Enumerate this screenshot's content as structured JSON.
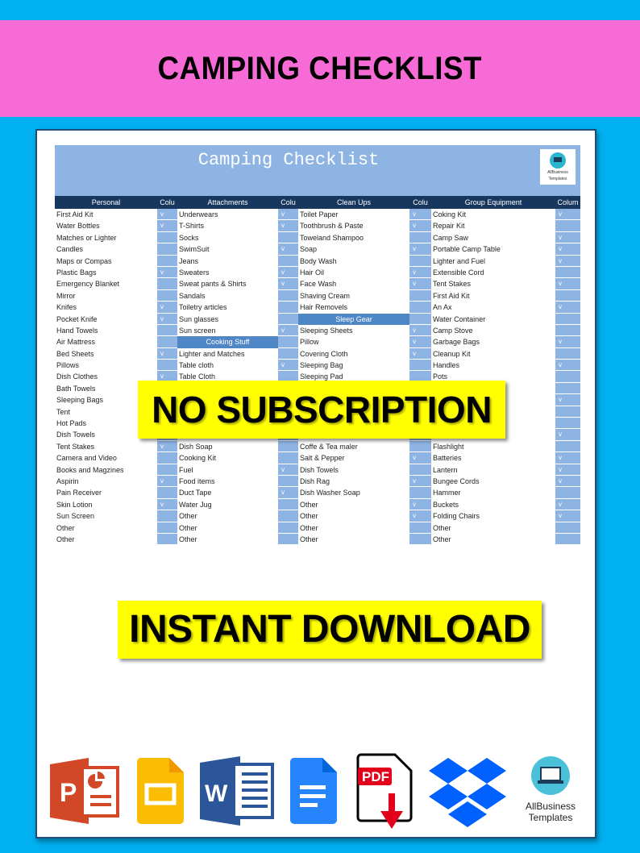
{
  "page": {
    "title": "CAMPING CHECKLIST",
    "colors": {
      "background": "#00b0f0",
      "title_band": "#f76bd6",
      "banner": "#ffff00",
      "sheet_header": "#17375e",
      "sheet_title_band": "#8eb4e3",
      "section_header": "#4f86c6"
    }
  },
  "sheet": {
    "title": "Camping Checklist",
    "logo_text_1": "AllBusiness",
    "logo_text_2": "Templates",
    "headers": [
      "Personal",
      "Colu",
      "Attachments",
      "Colu",
      "Clean Ups",
      "Colu",
      "Group Equipment",
      "Colum"
    ],
    "check_mark": "v",
    "columns": [
      {
        "name": "Personal",
        "rows": [
          {
            "label": "First Aid Kit",
            "checked": true
          },
          {
            "label": "Water Bottles",
            "checked": true
          },
          {
            "label": "Matches or Lighter",
            "checked": false
          },
          {
            "label": "Candles",
            "checked": false
          },
          {
            "label": "Maps or Compas",
            "checked": false
          },
          {
            "label": "Plastic Bags",
            "checked": true
          },
          {
            "label": "Emergency Blanket",
            "checked": false
          },
          {
            "label": "Mirror",
            "checked": false
          },
          {
            "label": "Knifes",
            "checked": true
          },
          {
            "label": "Pocket Knife",
            "checked": true
          },
          {
            "label": "Hand Towels",
            "checked": false
          },
          {
            "label": "Air Mattress",
            "checked": false
          },
          {
            "label": "Bed Sheets",
            "checked": true
          },
          {
            "label": "Pillows",
            "checked": false
          },
          {
            "label": "Dish Clothes",
            "checked": true
          },
          {
            "label": "Bath Towels",
            "checked": false
          },
          {
            "label": "Sleeping Bags",
            "checked": false
          },
          {
            "label": "Tent",
            "checked": false
          },
          {
            "label": "Hot Pads",
            "checked": false
          },
          {
            "label": "Dish Towels",
            "checked": false
          },
          {
            "label": "Tent Stakes",
            "checked": true
          },
          {
            "label": "Camera and Video",
            "checked": false
          },
          {
            "label": "Books and Magzines",
            "checked": false
          },
          {
            "label": "Aspirin",
            "checked": true
          },
          {
            "label": "Pain Receiver",
            "checked": false
          },
          {
            "label": "Skin Lotion",
            "checked": true
          },
          {
            "label": "Sun Screen",
            "checked": false
          },
          {
            "label": "Other",
            "checked": false
          },
          {
            "label": "Other",
            "checked": false
          }
        ]
      },
      {
        "name": "Attachments",
        "rows": [
          {
            "label": "Underwears",
            "checked": true
          },
          {
            "label": "T-Shirts",
            "checked": true
          },
          {
            "label": "Socks",
            "checked": false
          },
          {
            "label": "SwimSuit",
            "checked": true
          },
          {
            "label": "Jeans",
            "checked": false
          },
          {
            "label": "Sweaters",
            "checked": true
          },
          {
            "label": "Sweat pants & Shirts",
            "checked": true
          },
          {
            "label": "Sandals",
            "checked": false
          },
          {
            "label": "Toiletry articles",
            "checked": false
          },
          {
            "label": "Sun glasses",
            "checked": false
          },
          {
            "label": "Sun screen",
            "checked": true
          },
          {
            "label": "Cooking Stuff",
            "section": true,
            "checked": false
          },
          {
            "label": "Lighter and Matches",
            "checked": false
          },
          {
            "label": "Table cloth",
            "checked": true
          },
          {
            "label": "Table Cloth",
            "checked": false
          },
          {
            "label": "",
            "checked": false
          },
          {
            "label": "",
            "checked": false
          },
          {
            "label": "",
            "checked": false
          },
          {
            "label": "",
            "checked": false
          },
          {
            "label": "",
            "checked": false
          },
          {
            "label": "Dish Soap",
            "checked": false
          },
          {
            "label": "Cooking Kit",
            "checked": false
          },
          {
            "label": "Fuel",
            "checked": true
          },
          {
            "label": "Food items",
            "checked": false
          },
          {
            "label": "Duct Tape",
            "checked": true
          },
          {
            "label": "Water Jug",
            "checked": false
          },
          {
            "label": "Other",
            "checked": false
          },
          {
            "label": "Other",
            "checked": false
          },
          {
            "label": "Other",
            "checked": false
          }
        ]
      },
      {
        "name": "Clean Ups",
        "rows": [
          {
            "label": "Toilet Paper",
            "checked": true
          },
          {
            "label": "Toothbrush & Paste",
            "checked": true
          },
          {
            "label": "Toweland Shampoo",
            "checked": false
          },
          {
            "label": "Soap",
            "checked": true
          },
          {
            "label": "Body Wash",
            "checked": false
          },
          {
            "label": "Hair Oil",
            "checked": true
          },
          {
            "label": "Face Wash",
            "checked": true
          },
          {
            "label": "Shaving Cream",
            "checked": false
          },
          {
            "label": "Hair Removels",
            "checked": false
          },
          {
            "label": "Sleep Gear",
            "section": true,
            "checked": false
          },
          {
            "label": "Sleeping Sheets",
            "checked": true
          },
          {
            "label": "Pillow",
            "checked": true
          },
          {
            "label": "Covering Cloth",
            "checked": true
          },
          {
            "label": "Sleeping Bag",
            "checked": false
          },
          {
            "label": "Sleeping Pad",
            "checked": false
          },
          {
            "label": "",
            "checked": false
          },
          {
            "label": "",
            "checked": false
          },
          {
            "label": "",
            "checked": false
          },
          {
            "label": "",
            "checked": false
          },
          {
            "label": "",
            "checked": false
          },
          {
            "label": "Coffe & Tea maler",
            "checked": false
          },
          {
            "label": "Salt & Pepper",
            "checked": true
          },
          {
            "label": "Dish Towels",
            "checked": false
          },
          {
            "label": "Dish Rag",
            "checked": true
          },
          {
            "label": "Dish Washer Soap",
            "checked": false
          },
          {
            "label": "Other",
            "checked": true
          },
          {
            "label": "Other",
            "checked": true
          },
          {
            "label": "Other",
            "checked": false
          },
          {
            "label": "Other",
            "checked": false
          }
        ]
      },
      {
        "name": "Group Equipment",
        "rows": [
          {
            "label": "Coking Kit",
            "checked": true
          },
          {
            "label": "Repair Kit",
            "checked": false
          },
          {
            "label": "Camp Saw",
            "checked": true
          },
          {
            "label": "Portable Camp Table",
            "checked": true
          },
          {
            "label": "Lighter and Fuel",
            "checked": true
          },
          {
            "label": "Extensible Cord",
            "checked": false
          },
          {
            "label": "Tent Stakes",
            "checked": true
          },
          {
            "label": "First Aid Kit",
            "checked": false
          },
          {
            "label": "An Ax",
            "checked": true
          },
          {
            "label": "Water Container",
            "checked": false
          },
          {
            "label": "Camp Stove",
            "checked": false
          },
          {
            "label": "Garbage Bags",
            "checked": true
          },
          {
            "label": "Cleanup Kit",
            "checked": false
          },
          {
            "label": "Handles",
            "checked": true
          },
          {
            "label": "Pots",
            "checked": false
          },
          {
            "label": "",
            "checked": false
          },
          {
            "label": "",
            "checked": true
          },
          {
            "label": "",
            "checked": false
          },
          {
            "label": "",
            "checked": false
          },
          {
            "label": "",
            "checked": true
          },
          {
            "label": "Flashlight",
            "checked": false
          },
          {
            "label": "Batteries",
            "checked": true
          },
          {
            "label": "Lantern",
            "checked": true
          },
          {
            "label": "Bungee Cords",
            "checked": true
          },
          {
            "label": "Hammer",
            "checked": false
          },
          {
            "label": "Buckets",
            "checked": true
          },
          {
            "label": "Folding Chairs",
            "checked": true
          },
          {
            "label": "Other",
            "checked": false
          },
          {
            "label": "Other",
            "checked": false
          }
        ]
      }
    ]
  },
  "banners": {
    "no_subscription": "NO SUBSCRIPTION",
    "instant_download": "INSTANT DOWNLOAD"
  },
  "formats": {
    "icons": [
      "powerpoint-icon",
      "google-slides-icon",
      "word-icon",
      "google-docs-icon",
      "pdf-download-icon",
      "dropbox-icon",
      "allbusiness-templates-icon"
    ],
    "pdf_label": "PDF",
    "brand_line_1": "AllBusiness",
    "brand_line_2": "Templates"
  }
}
